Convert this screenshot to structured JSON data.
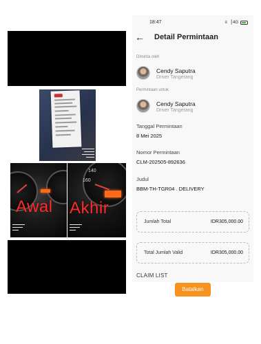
{
  "status_bar": {
    "time": "18:47",
    "icons": "≡ ▕ 4G"
  },
  "header": {
    "back_icon": "arrow-left-icon",
    "title": "Detail Permintaan"
  },
  "requested_by": {
    "label": "Diminta oleh",
    "name": "Cendy Saputra",
    "role": "Driver Tangerang"
  },
  "requested_for": {
    "label": "Permintaan untuk",
    "name": "Cendy Saputra",
    "role": "Driver Tangerang"
  },
  "date": {
    "label": "Tanggal Permintaan",
    "value": "8 Mei 2025"
  },
  "number": {
    "label": "Nomor Permintaan",
    "value": "CLM-202505-892636"
  },
  "subject": {
    "label": "Judul",
    "value": "BBM-TH-TGR04 . DELIVERY"
  },
  "totals": {
    "total_label": "Jumlah Total",
    "total_value": "IDR305,000.00",
    "valid_label": "Total Jumlah Valid",
    "valid_value": "IDR305,000.00"
  },
  "claim_list_title": "CLAIM LIST",
  "cancel_label": "Batalkan",
  "photos": {
    "awal_label": "Awal",
    "akhir_label": "Akhir"
  },
  "colors": {
    "accent": "#f7921e",
    "overlay_text": "#ff2a2a"
  }
}
